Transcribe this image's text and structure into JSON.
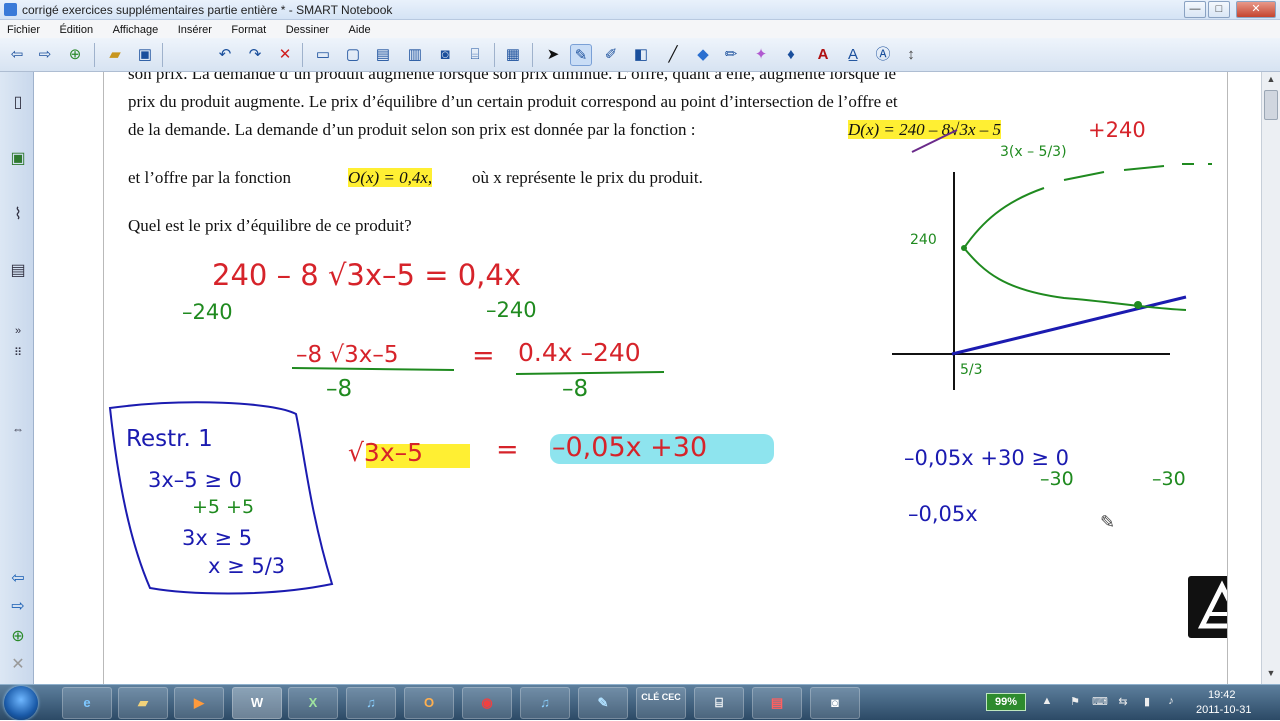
{
  "window": {
    "title": "corrigé exercices supplémentaires partie entière * - SMART Notebook",
    "controls": {
      "minimize": "—",
      "maximize": "□",
      "close": "✕"
    }
  },
  "menubar": [
    "Fichier",
    "Édition",
    "Affichage",
    "Insérer",
    "Format",
    "Dessiner",
    "Aide"
  ],
  "toolbar_icons": [
    "back-icon",
    "forward-icon",
    "add-page-icon",
    "open-icon",
    "save-icon",
    "undo-icon",
    "redo-icon",
    "delete-icon",
    "screen-shade-icon",
    "full-screen-icon",
    "dual-display-icon",
    "screen-capture-icon",
    "document-camera-icon",
    "table-icon",
    "select-icon",
    "pen-icon",
    "creative-pen-icon",
    "eraser-icon",
    "line-icon",
    "shapes-icon",
    "magic-pen-icon",
    "fill-icon",
    "text-icon",
    "properties-icon",
    "move-toolbar-icon"
  ],
  "sidebar_icons": [
    "page-sorter-icon",
    "gallery-icon",
    "attachments-icon",
    "properties-icon"
  ],
  "page": {
    "line1": "son prix.  La demande d’un produit augmente lorsque son prix diminue.  L’offre, quant à elle, augmente lorsque le",
    "line2": "prix du produit augmente.  Le prix d’équilibre d’un certain produit correspond au point d’intersection de l’offre et",
    "line3": "de la demande.  La demande d’un produit selon son prix est donnée par la fonction :",
    "demand_fn": "D(x) = 240 – 8√3x – 5",
    "line4_prefix": "et l’offre par la fonction",
    "offer_fn": "O(x) = 0,4x,",
    "line4_suffix": "où x représente le prix du produit.",
    "question": "Quel est le prix d’équilibre de ce produit?"
  },
  "ink": {
    "plus240": "+240",
    "factor": "3(x – 5/3)",
    "eq1": "240 – 8 √3x–5  = 0,4x",
    "eq1_sub_left": "–240",
    "eq1_sub_right": "–240",
    "eq2_num_left": "–8 √3x–5",
    "eq2_eq": "=",
    "eq2_num_right": "0.4x –240",
    "eq2_den_left": "–8",
    "eq2_den_right": "–8",
    "eq3_left": "√3x–5",
    "eq3_eq": "=",
    "eq3_right": "–0,05x +30",
    "restr_title": "Restr. 1",
    "restr_l1": "3x–5 ≥ 0",
    "restr_l2": "+5  +5",
    "restr_l3": "3x ≥ 5",
    "restr_l4": "x ≥ 5/3",
    "graph_y_label": "240",
    "graph_x_label": "5/3",
    "ineq_l1": "–0,05x +30  ≥ 0",
    "ineq_l2a": "–30",
    "ineq_l2b": "–30",
    "ineq_l3": "–0,05x"
  },
  "taskbar": {
    "apps": [
      "ie-icon",
      "explorer-icon",
      "media-icon",
      "word-icon",
      "excel-icon",
      "itunes-icon",
      "outlook-icon",
      "chrome-icon",
      "itunes2-icon",
      "notebook-icon",
      "clecec-icon",
      "scanner-icon",
      "pdf-icon",
      "camera-icon"
    ],
    "word_label": "W",
    "excel_label": "X",
    "clecec_label": "CLÉ CEC",
    "battery": "99%",
    "time": "19:42",
    "date": "2011-10-31"
  },
  "colors": {
    "red_ink": "#d6232a",
    "green_ink": "#1f8a1f",
    "blue_ink": "#1b1bb0",
    "highlight_yellow": "#ffef33",
    "highlight_cyan": "#8ee4ee"
  }
}
